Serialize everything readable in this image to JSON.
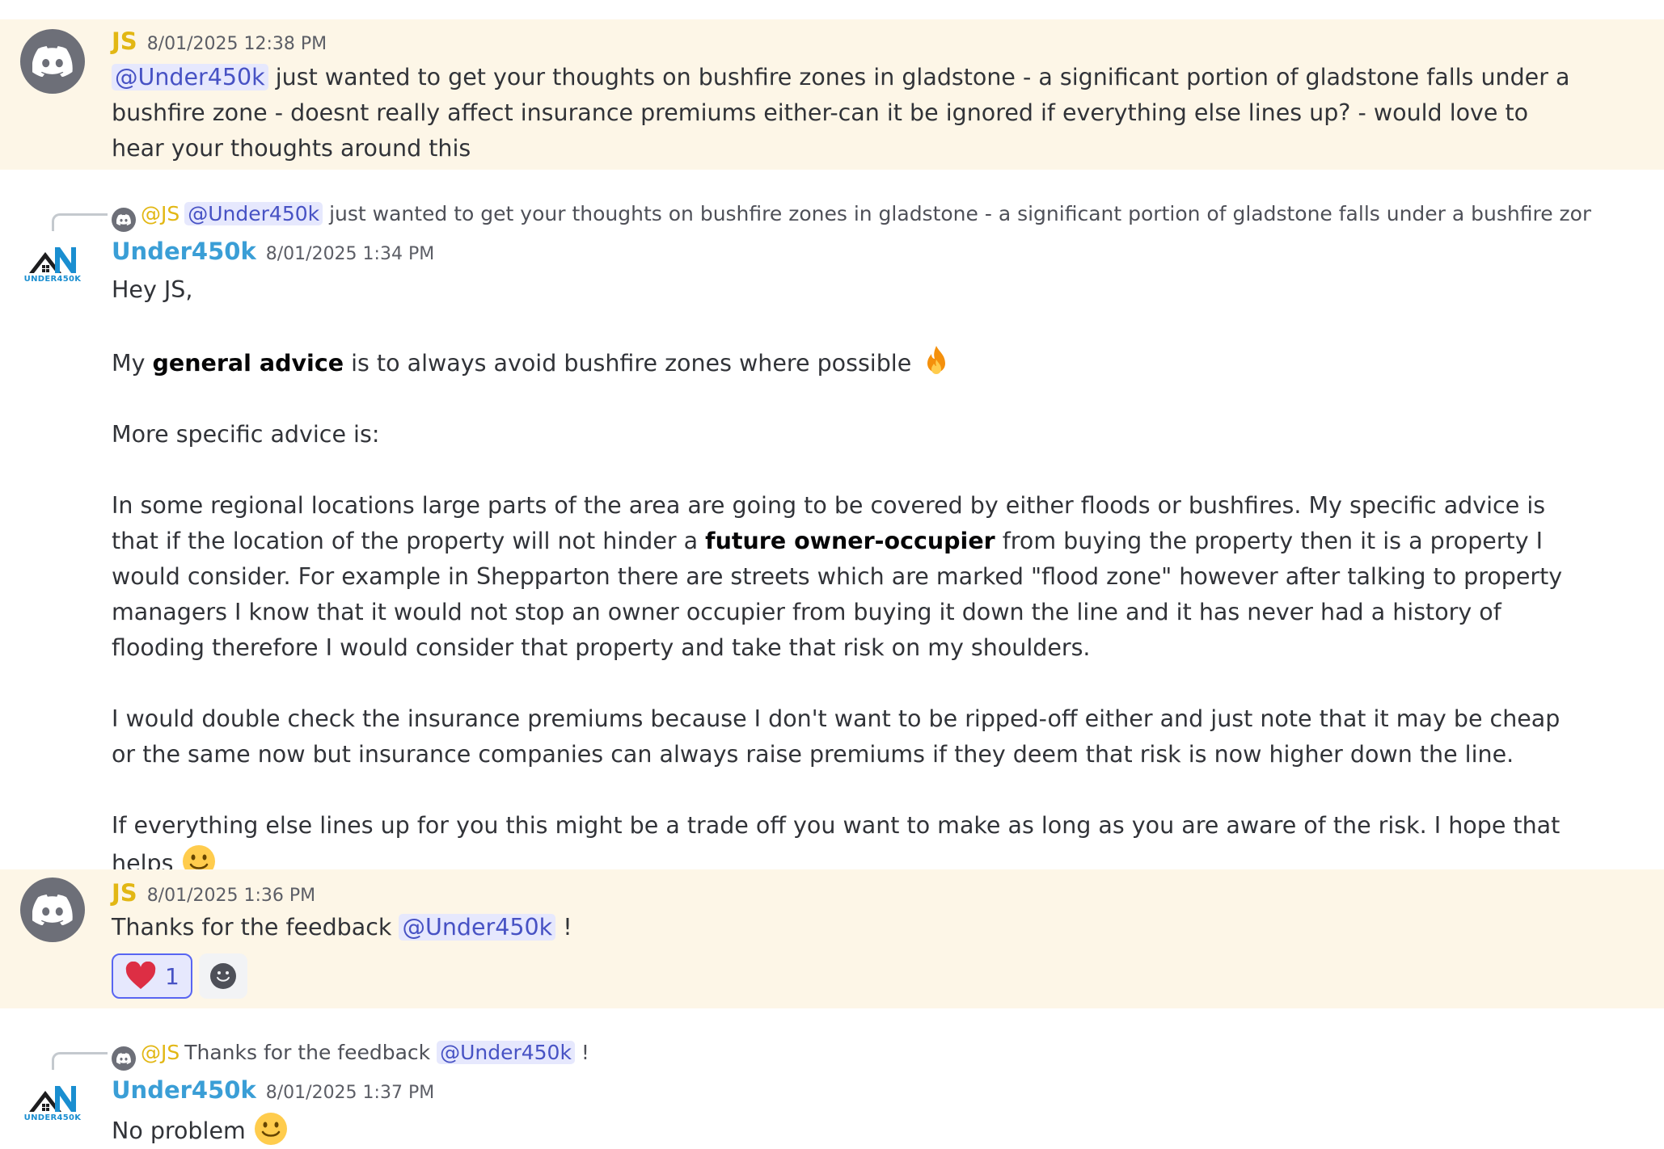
{
  "messages": [
    {
      "author": "JS",
      "timestamp": "8/01/2025 12:38 PM",
      "mention": "@Under450k",
      "text": "just wanted to get your thoughts on bushfire zones in gladstone - a significant portion of gladstone falls under a bushfire zone - doesnt really affect insurance premiums either-can it be ignored if everything else lines up? - would love to hear your thoughts around this"
    },
    {
      "reply": {
        "author": "@JS",
        "mention": "@Under450k",
        "text": "just wanted to get your thoughts on bushfire zones in gladstone - a significant portion of gladstone falls under a bushfire zone - ..."
      },
      "author": "Under450k",
      "avatar_text": "UNDER450K",
      "timestamp": "8/01/2025 1:34 PM",
      "greeting": "Hey JS,",
      "p2_before": "My ",
      "p2_bold": "general advice",
      "p2_after": " is to always avoid bushfire zones where possible",
      "p2_emoji": "fire-emoji",
      "p3": "More specific advice is:",
      "p4_before": "In some regional locations large parts of the area are going to be covered by either floods or bushfires. My specific advice is that if the location of the property will not hinder a ",
      "p4_bold": "future owner-occupier",
      "p4_after": " from buying the property then it is a property I would consider. For example in Shepparton there are streets which are marked \"flood zone\" however after talking to property managers I know that it would not stop an owner occupier from buying it down the line and it has never had a history of flooding therefore I would consider that property and take that risk on my shoulders.",
      "p5": "I would double check the insurance premiums because I don't want to be ripped-off either and just note that it may be cheap or the same now but insurance companies can always raise premiums if they deem that risk is now higher down the line.",
      "p6": "If everything else lines up for you this might be a trade off you want to make as long as you are aware of the risk. I hope that helps",
      "p6_emoji": "slight-smile-emoji"
    },
    {
      "author": "JS",
      "timestamp": "8/01/2025 1:36 PM",
      "text_before": "Thanks for the feedback",
      "mention": "@Under450k",
      "text_after": "!",
      "reaction": {
        "emoji": "heart-emoji",
        "count": "1"
      }
    },
    {
      "reply": {
        "author": "@JS",
        "text_before": "Thanks for the feedback",
        "mention": "@Under450k",
        "text_after": "!"
      },
      "author": "Under450k",
      "avatar_text": "UNDER450K",
      "timestamp": "8/01/2025 1:37 PM",
      "text": "No problem",
      "emoji": "slight-smile-emoji"
    }
  ],
  "colors": {
    "highlight": "#fdf6e7",
    "js_name": "#e2b714",
    "under450k_name": "#3a9ed6",
    "mention_bg": "#e6e8fd",
    "mention_text": "#4752c4"
  }
}
